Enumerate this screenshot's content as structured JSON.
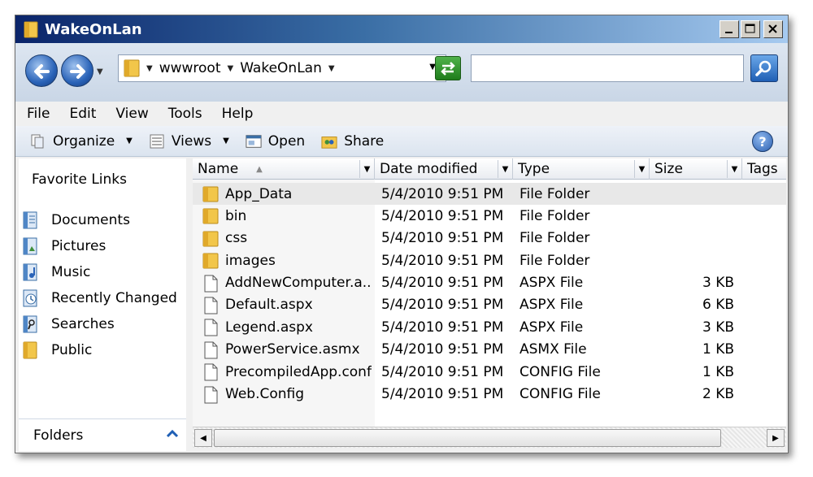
{
  "window": {
    "title": "WakeOnLan"
  },
  "address": {
    "crumbs": [
      "wwwroot",
      "WakeOnLan"
    ],
    "search_value": ""
  },
  "menu": [
    "File",
    "Edit",
    "View",
    "Tools",
    "Help"
  ],
  "toolbar": {
    "organize": "Organize",
    "views": "Views",
    "open": "Open",
    "share": "Share",
    "help": "?"
  },
  "navpane": {
    "heading": "Favorite Links",
    "items": [
      "Documents",
      "Pictures",
      "Music",
      "Recently Changed",
      "Searches",
      "Public"
    ],
    "folders_label": "Folders"
  },
  "columns": {
    "name": "Name",
    "date": "Date modified",
    "type": "Type",
    "size": "Size",
    "tags": "Tags"
  },
  "files": [
    {
      "name": "App_Data",
      "date": "5/4/2010 9:51 PM",
      "type": "File Folder",
      "size": "",
      "icon": "folder-icon"
    },
    {
      "name": "bin",
      "date": "5/4/2010 9:51 PM",
      "type": "File Folder",
      "size": "",
      "icon": "folder-icon"
    },
    {
      "name": "css",
      "date": "5/4/2010 9:51 PM",
      "type": "File Folder",
      "size": "",
      "icon": "folder-icon"
    },
    {
      "name": "images",
      "date": "5/4/2010 9:51 PM",
      "type": "File Folder",
      "size": "",
      "icon": "folder-icon"
    },
    {
      "name": "AddNewComputer.a...",
      "date": "5/4/2010 9:51 PM",
      "type": "ASPX File",
      "size": "3 KB",
      "icon": "file-icon"
    },
    {
      "name": "Default.aspx",
      "date": "5/4/2010 9:51 PM",
      "type": "ASPX File",
      "size": "6 KB",
      "icon": "file-icon"
    },
    {
      "name": "Legend.aspx",
      "date": "5/4/2010 9:51 PM",
      "type": "ASPX File",
      "size": "3 KB",
      "icon": "file-icon"
    },
    {
      "name": "PowerService.asmx",
      "date": "5/4/2010 9:51 PM",
      "type": "ASMX File",
      "size": "1 KB",
      "icon": "file-icon"
    },
    {
      "name": "PrecompiledApp.config",
      "date": "5/4/2010 9:51 PM",
      "type": "CONFIG File",
      "size": "1 KB",
      "icon": "file-icon"
    },
    {
      "name": "Web.Config",
      "date": "5/4/2010 9:51 PM",
      "type": "CONFIG File",
      "size": "2 KB",
      "icon": "file-icon"
    }
  ],
  "colors": {
    "folder": "#f2c64a",
    "title_dark": "#0a246a",
    "title_light": "#a6caf0",
    "selected_row": "#e8e8e8"
  }
}
